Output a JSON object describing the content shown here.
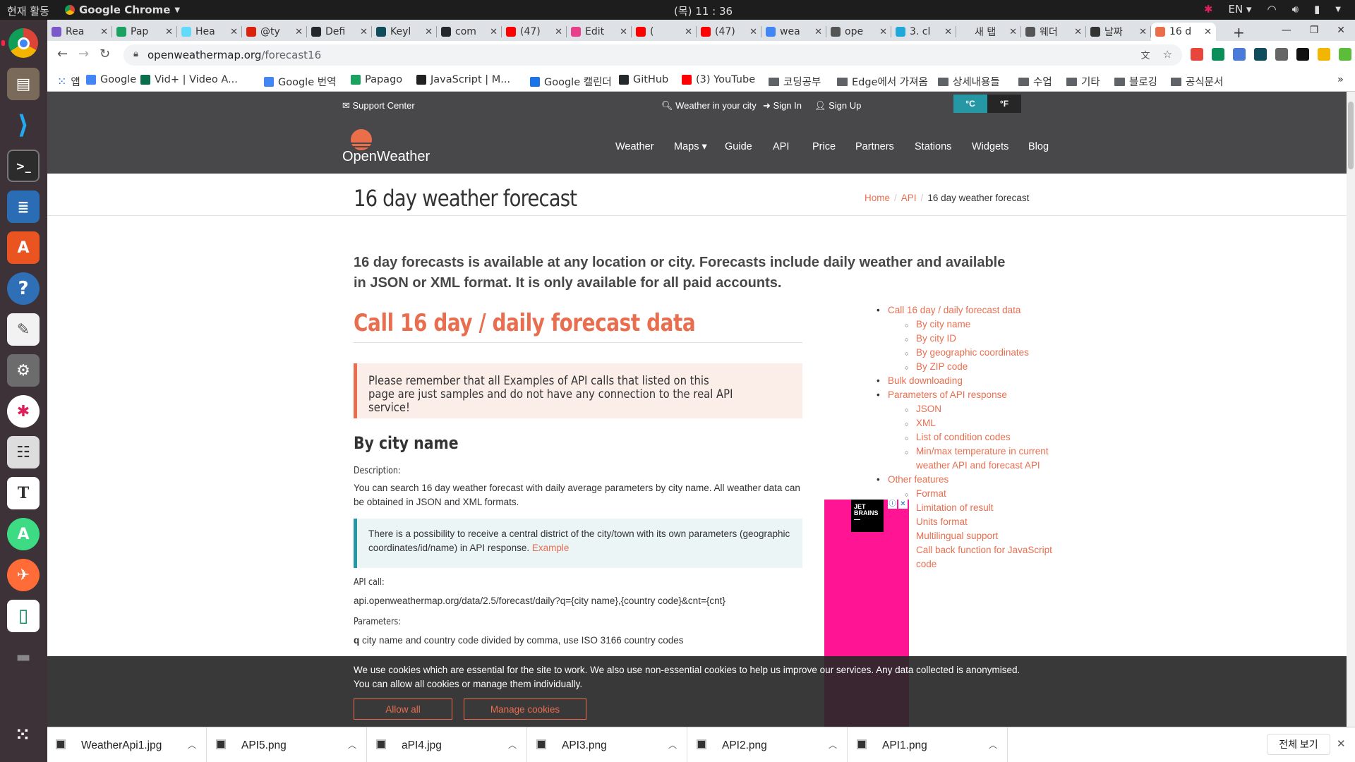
{
  "topbar": {
    "activities": "현재 활동",
    "app_name": "Google Chrome",
    "clock": "(목) 11 : 36",
    "lang": "EN"
  },
  "tabs": [
    {
      "label": "Rea",
      "color": "#7b57c9"
    },
    {
      "label": "Pap",
      "color": "#1aa260"
    },
    {
      "label": "Hea",
      "color": "#61dafb"
    },
    {
      "label": "@ty",
      "color": "#d9230f"
    },
    {
      "label": "Defi",
      "color": "#24292e"
    },
    {
      "label": "Keyl",
      "color": "#0f4c5c"
    },
    {
      "label": "com",
      "color": "#24292e"
    },
    {
      "label": "(47)",
      "color": "#ff0000"
    },
    {
      "label": "Edit",
      "color": "#e83e8c"
    },
    {
      "label": "(",
      "color": "#ff0000"
    },
    {
      "label": "(47)",
      "color": "#ff0000"
    },
    {
      "label": "wea",
      "color": "#4285f4"
    },
    {
      "label": "ope",
      "color": "#555555"
    },
    {
      "label": "3. cl",
      "color": "#20a8d8"
    },
    {
      "label": "새 탭",
      "color": "#dee1e6"
    },
    {
      "label": "웨더",
      "color": "#555555"
    },
    {
      "label": "날짜",
      "color": "#333333"
    },
    {
      "label": "16 d",
      "color": "#eb6e4b"
    }
  ],
  "toolbar": {
    "url_host": "openweathermap.org",
    "url_path": "/forecast16"
  },
  "bookmarks": [
    {
      "label": "앱",
      "type": "apps"
    },
    {
      "label": "Google",
      "type": "site",
      "color": "#4285f4"
    },
    {
      "label": "Vid+ | Video A...",
      "type": "site",
      "color": "#0b6e4f"
    },
    {
      "label": "Google 번역",
      "type": "site",
      "color": "#4285f4"
    },
    {
      "label": "Papago",
      "type": "site",
      "color": "#1aa260"
    },
    {
      "label": "JavaScript | M...",
      "type": "site",
      "color": "#222222"
    },
    {
      "label": "Google 캘린더",
      "type": "site",
      "color": "#1a73e8"
    },
    {
      "label": "GitHub",
      "type": "site",
      "color": "#24292e"
    },
    {
      "label": "(3) YouTube",
      "type": "site",
      "color": "#ff0000"
    },
    {
      "label": "코딩공부",
      "type": "folder"
    },
    {
      "label": "Edge에서 가져옴",
      "type": "folder"
    },
    {
      "label": "상세내용들",
      "type": "folder"
    },
    {
      "label": "수업",
      "type": "folder"
    },
    {
      "label": "기타",
      "type": "folder"
    },
    {
      "label": "블로깅",
      "type": "folder"
    },
    {
      "label": "공식문서",
      "type": "folder"
    }
  ],
  "ow_top": {
    "support": "Support Center",
    "weather_city": "Weather in your city",
    "sign_in": "Sign In",
    "sign_up": "Sign Up",
    "unit_c": "°C",
    "unit_f": "°F"
  },
  "ow_nav": {
    "logo": "OpenWeather",
    "links": [
      "Weather",
      "Maps ▾",
      "Guide",
      "API",
      "Price",
      "Partners",
      "Stations",
      "Widgets",
      "Blog"
    ]
  },
  "page": {
    "title": "16 day weather forecast",
    "crumb_home": "Home",
    "crumb_api": "API",
    "crumb_current": "16 day weather forecast",
    "lead": "16 day forecasts is available at any location or city. Forecasts include daily weather and available in JSON or XML format. It is only available for all paid accounts.",
    "h2": "Call 16 day / daily forecast data",
    "warning": "Please remember that all Examples of API calls that listed on this page are just samples and do not have any connection to the real API service!",
    "h3": "By city name",
    "desc_label": "Description:",
    "desc": "You can search 16 day weather forecast with daily average parameters by city name. All weather data can be obtained in JSON and XML formats.",
    "info": "There is a possibility to receive a central district of the city/town with its own parameters (geographic coordinates/id/name) in API response.",
    "info_link": "Example",
    "apicall_label": "API call:",
    "apicall": "api.openweathermap.org/data/2.5/forecast/daily?q={city name},{country code}&cnt={cnt}",
    "params_label": "Parameters:",
    "param_q_key": "q",
    "param_q": "city name and country code divided by comma, use ISO 3166 country codes"
  },
  "toc": [
    {
      "label": "Call 16 day / daily forecast data",
      "level": 1
    },
    {
      "label": "By city name",
      "level": 2
    },
    {
      "label": "By city ID",
      "level": 2
    },
    {
      "label": "By geographic coordinates",
      "level": 2
    },
    {
      "label": "By ZIP code",
      "level": 2
    },
    {
      "label": "Bulk downloading",
      "level": 1
    },
    {
      "label": "Parameters of API response",
      "level": 1
    },
    {
      "label": "JSON",
      "level": 2
    },
    {
      "label": "XML",
      "level": 2
    },
    {
      "label": "List of condition codes",
      "level": 2
    },
    {
      "label": "Min/max temperature in current weather API and forecast API",
      "level": 2
    },
    {
      "label": "Other features",
      "level": 1
    },
    {
      "label": "Format",
      "level": 2
    },
    {
      "label": "Limitation of result",
      "level": 2
    },
    {
      "label": "Units format",
      "level": 2
    },
    {
      "label": "Multilingual support",
      "level": 2
    },
    {
      "label": "Call back function for JavaScript code",
      "level": 2
    }
  ],
  "ad": {
    "brand_line1": "JET",
    "brand_line2": "BRAINS"
  },
  "cookie": {
    "text": "We use cookies which are essential for the site to work. We also use non-essential cookies to help us improve our services. Any data collected is anonymised. You can allow all cookies or manage them individually.",
    "allow": "Allow all",
    "manage": "Manage cookies"
  },
  "downloads": {
    "files": [
      "WeatherApi1.jpg",
      "API5.png",
      "aPI4.jpg",
      "API3.png",
      "API2.png",
      "API1.png"
    ],
    "show_all": "전체 보기"
  }
}
